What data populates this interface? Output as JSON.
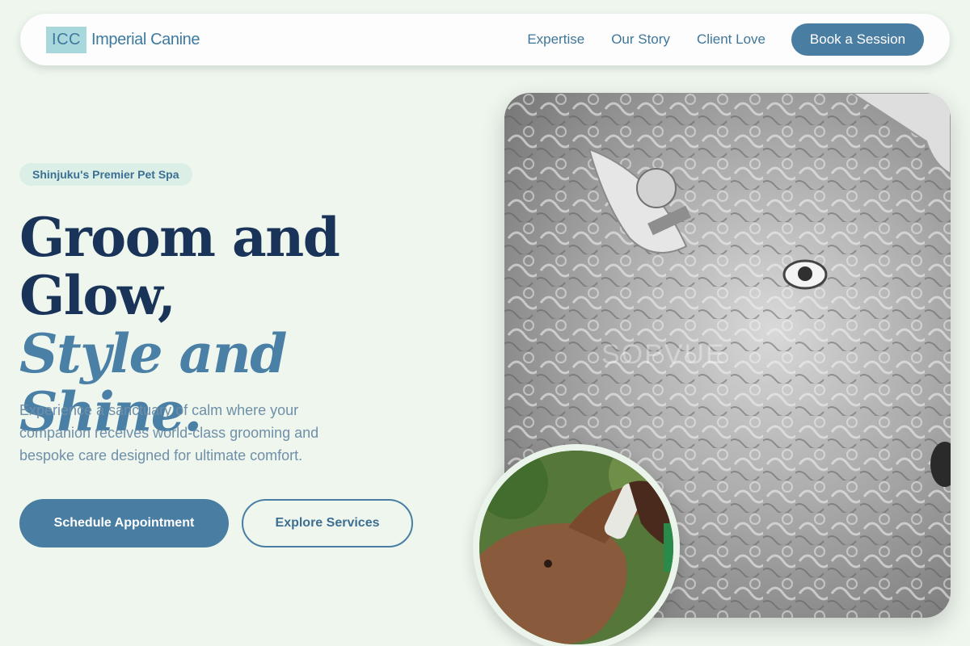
{
  "nav": {
    "logo_mark": "ICC",
    "brand_name": "Imperial Canine",
    "links": [
      "Expertise",
      "Our Story",
      "Client Love"
    ],
    "cta": "Book a Session"
  },
  "hero": {
    "badge": "Shinjuku's Premier Pet Spa",
    "headline_line1": "Groom and",
    "headline_line2": "Glow,",
    "headline_accent": "Style and Shine.",
    "subtext": "Experience a sanctuary of calm where your companion receives world-class grooming and bespoke care designed for ultimate comfort.",
    "primary_button": "Schedule Appointment",
    "secondary_button": "Explore Services"
  },
  "images": {
    "main_icon": "sheep-photo",
    "main_watermark": "SOPVUE",
    "circle_icon": "elephant-feeding-photo"
  },
  "colors": {
    "background": "#eef6ee",
    "primary": "#4a7da2",
    "heading": "#1a3459",
    "accent": "#4a7fa6",
    "muted": "#6f8fa8"
  }
}
